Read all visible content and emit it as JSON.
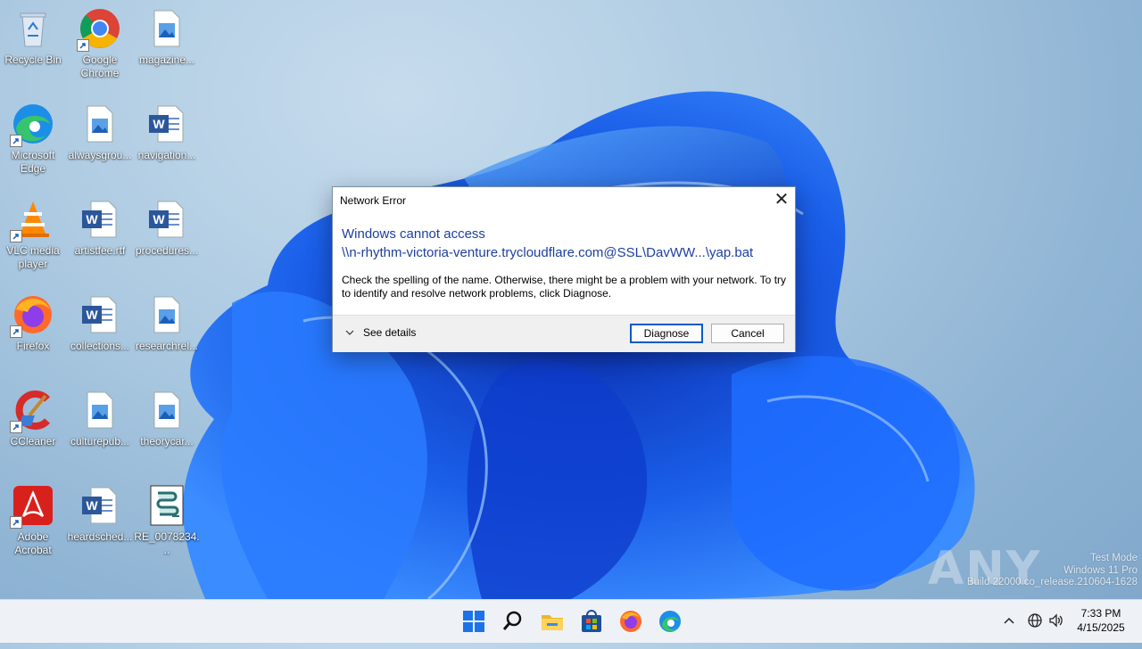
{
  "desktop": {
    "icons": [
      {
        "label": "Recycle Bin",
        "icon": "recycle-bin-icon"
      },
      {
        "label": "Google Chrome",
        "icon": "chrome-icon"
      },
      {
        "label": "magazine...",
        "icon": "image-file-icon"
      },
      {
        "label": "Microsoft Edge",
        "icon": "edge-icon"
      },
      {
        "label": "alwaysgrou...",
        "icon": "image-file-icon"
      },
      {
        "label": "navigation...",
        "icon": "word-document-icon"
      },
      {
        "label": "VLC media player",
        "icon": "vlc-icon"
      },
      {
        "label": "artistfee.rtf",
        "icon": "word-document-icon"
      },
      {
        "label": "procedures...",
        "icon": "word-document-icon"
      },
      {
        "label": "Firefox",
        "icon": "firefox-icon"
      },
      {
        "label": "collections...",
        "icon": "word-document-icon"
      },
      {
        "label": "researchrel...",
        "icon": "image-file-icon"
      },
      {
        "label": "CCleaner",
        "icon": "ccleaner-icon"
      },
      {
        "label": "culturepub...",
        "icon": "image-file-icon"
      },
      {
        "label": "theorycar...",
        "icon": "image-file-icon"
      },
      {
        "label": "Adobe Acrobat",
        "icon": "acrobat-icon"
      },
      {
        "label": "heardsched...",
        "icon": "word-document-icon"
      },
      {
        "label": "RE_0078234...",
        "icon": "script-file-icon"
      }
    ]
  },
  "dialog": {
    "title": "Network Error",
    "close_glyph": "✕",
    "heading_line1": "Windows cannot access",
    "heading_line2": "\\\\n-rhythm-victoria-venture.trycloudflare.com@SSL\\DavWW...\\yap.bat",
    "body": "Check the spelling of the name. Otherwise, there might be a problem with your network. To try to identify and resolve network problems, click Diagnose.",
    "details_label": "See details",
    "diagnose_label": "Diagnose",
    "cancel_label": "Cancel"
  },
  "watermark": {
    "brand": "ANY RUN",
    "line1": "Test Mode",
    "line2": "Windows 11 Pro",
    "line3": "Build 22000.co_release.210604-1628"
  },
  "taskbar": {
    "items": [
      "start-icon",
      "search-icon",
      "file-explorer-icon",
      "store-icon",
      "firefox-icon",
      "edge-icon"
    ],
    "tray_chevron": "^",
    "time": "7:33 PM",
    "date": "4/15/2025"
  },
  "colors": {
    "wallpaper_blue": "#1565e8",
    "heading_blue": "#1c3fa0",
    "default_button_border": "#0a59c9"
  }
}
